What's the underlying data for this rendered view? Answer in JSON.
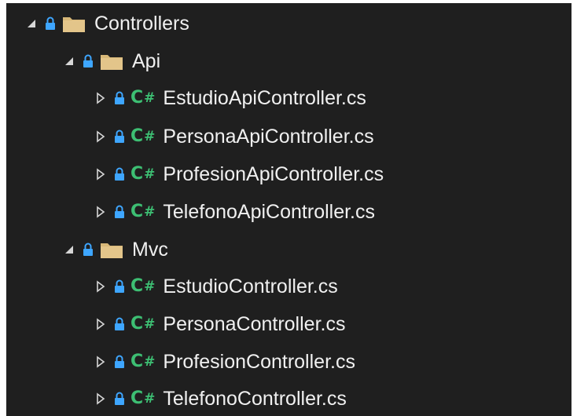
{
  "explorer": {
    "tree": [
      {
        "label": "Controllers",
        "kind": "folder",
        "expanded": true
      },
      {
        "label": "Api",
        "kind": "folder",
        "expanded": true
      },
      {
        "label": "EstudioApiController.cs",
        "kind": "csharp-file",
        "expanded": false
      },
      {
        "label": "PersonaApiController.cs",
        "kind": "csharp-file",
        "expanded": false
      },
      {
        "label": "ProfesionApiController.cs",
        "kind": "csharp-file",
        "expanded": false
      },
      {
        "label": "TelefonoApiController.cs",
        "kind": "csharp-file",
        "expanded": false
      },
      {
        "label": "Mvc",
        "kind": "folder",
        "expanded": true
      },
      {
        "label": "EstudioController.cs",
        "kind": "csharp-file",
        "expanded": false
      },
      {
        "label": "PersonaController.cs",
        "kind": "csharp-file",
        "expanded": false
      },
      {
        "label": "ProfesionController.cs",
        "kind": "csharp-file",
        "expanded": false
      },
      {
        "label": "TelefonoController.cs",
        "kind": "csharp-file",
        "expanded": false
      }
    ],
    "icons": {
      "expanded": "expanded-triangle-icon",
      "collapsed": "collapsed-triangle-icon",
      "lock": "lock-icon",
      "folder": "folder-icon",
      "csharp": "csharp-file-icon"
    },
    "colors": {
      "background": "#1f1f1f",
      "text": "#f0f0f0",
      "lock": "#3ea6ff",
      "csharp": "#3dbf73",
      "folder": "#d8b878"
    }
  }
}
